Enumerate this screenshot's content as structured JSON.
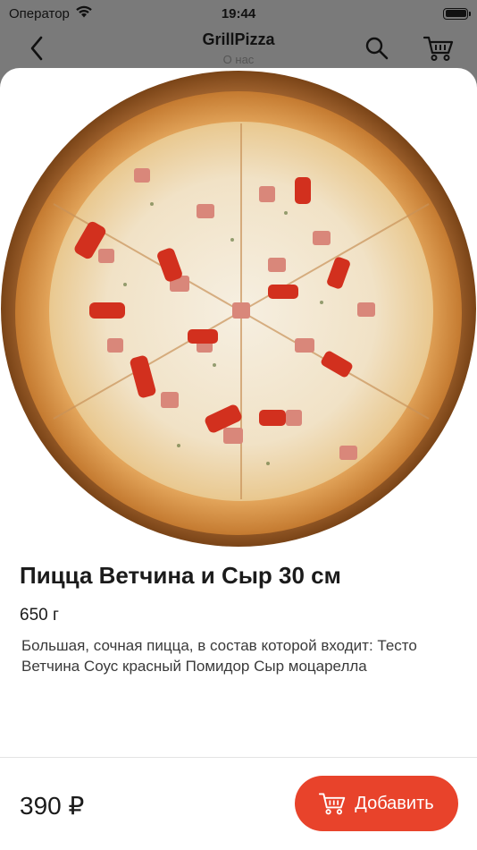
{
  "status_bar": {
    "carrier": "Оператор",
    "time": "19:44",
    "icons": [
      "wifi-icon",
      "battery-icon"
    ]
  },
  "nav": {
    "title": "GrillPizza",
    "subtitle": "О нас",
    "icons": [
      "back-chevron-icon",
      "search-icon",
      "cart-icon"
    ]
  },
  "product": {
    "title": "Пицца Ветчина и Сыр 30 см",
    "weight": "650 г",
    "description": "Большая, сочная пицца, в состав которой входит: Тесто Ветчина Соус красный Помидор Сыр моцарелла",
    "price": "390 ₽",
    "image": "pizza-photo"
  },
  "actions": {
    "add_label": "Добавить"
  },
  "colors": {
    "accent": "#e8432b",
    "overlay": "#7a7a7a"
  }
}
